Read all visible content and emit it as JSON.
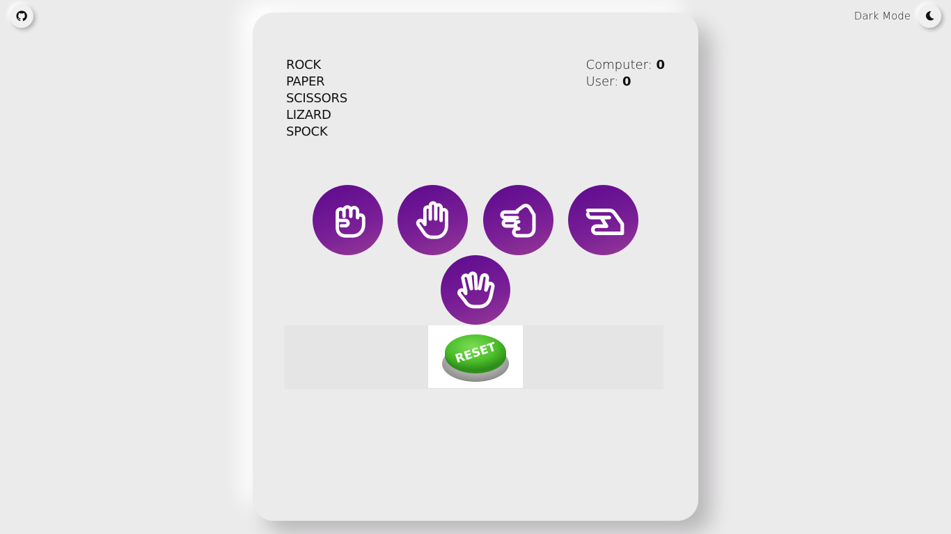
{
  "header": {
    "github_icon": "github-icon",
    "dark_mode_label": "Dark Mode",
    "moon_icon": "moon-icon"
  },
  "game": {
    "title_lines": [
      "ROCK",
      "PAPER",
      "SCISSORS",
      "LIZARD",
      "SPOCK"
    ],
    "score": {
      "computer_label": "Computer:",
      "computer_value": "0",
      "user_label": "User:",
      "user_value": "0"
    },
    "choices": [
      {
        "name": "rock",
        "icon": "fist-icon"
      },
      {
        "name": "paper",
        "icon": "open-hand-icon"
      },
      {
        "name": "scissors",
        "icon": "scissors-hand-icon"
      },
      {
        "name": "lizard",
        "icon": "lizard-hand-icon"
      },
      {
        "name": "spock",
        "icon": "vulcan-salute-icon"
      }
    ],
    "reset_label": "RESET",
    "colors": {
      "choice_gradient_start": "#5c0a8e",
      "choice_gradient_end": "#963a95",
      "reset_green": "#4cbf2c",
      "background": "#ecebec"
    }
  }
}
